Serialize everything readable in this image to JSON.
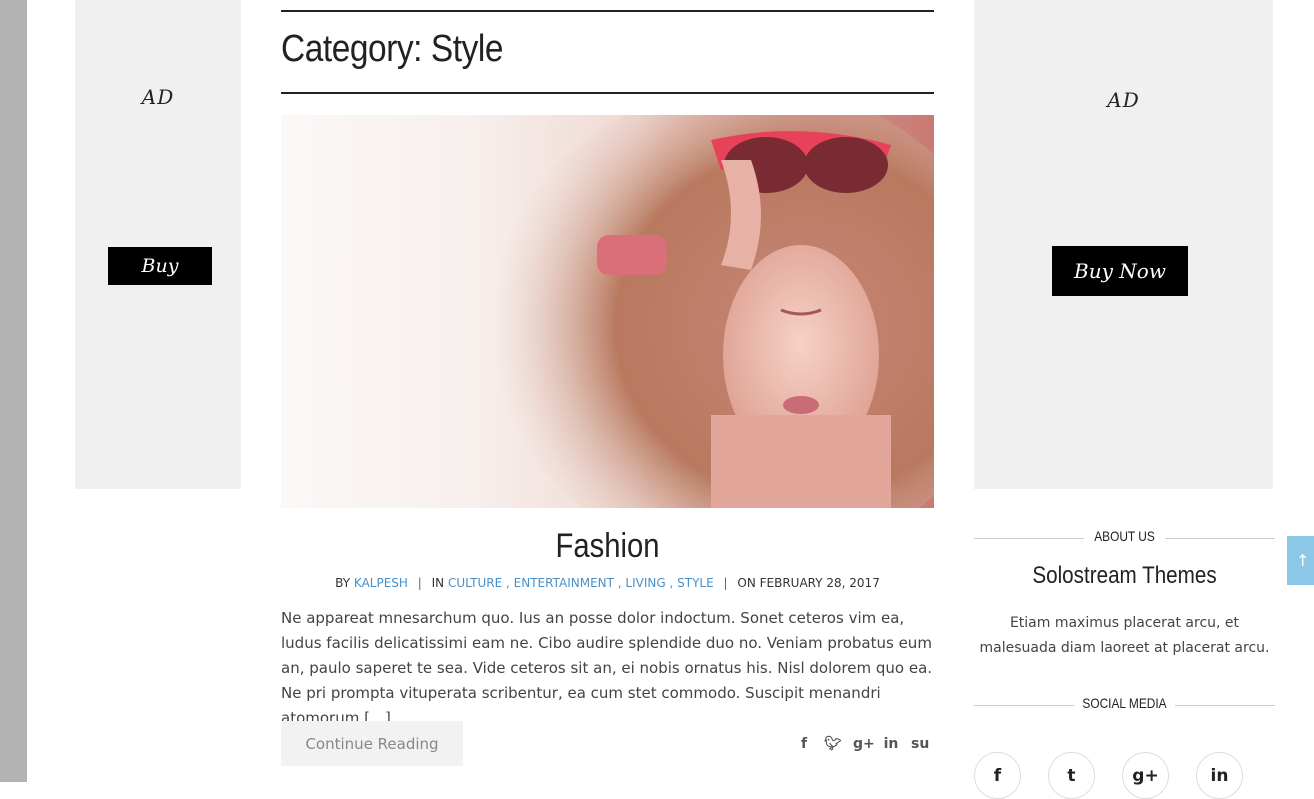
{
  "ads": {
    "left": {
      "label": "AD",
      "button": "Buy"
    },
    "right": {
      "label": "AD",
      "button": "Buy Now"
    }
  },
  "category": {
    "title": "Category: Style"
  },
  "post": {
    "image_alt": "Woman with curly hair and red sunglasses",
    "title": "Fashion",
    "meta": {
      "by_label": "BY",
      "author": "KALPESH",
      "in_label": "IN",
      "categories": [
        "CULTURE",
        "ENTERTAINMENT",
        "LIVING",
        "STYLE"
      ],
      "on_label": "ON",
      "date": "FEBRUARY 28, 2017"
    },
    "excerpt": "Ne appareat mnesarchum quo. Ius an posse dolor indoctum. Sonet ceteros vim ea, ludus facilis delicatissimi eam ne. Cibo audire splendide duo no. Veniam probatus eum an, paulo saperet te sea. Vide ceteros sit an, ei nobis ornatus his. Nisl dolorem quo ea. Ne pri prompta vituperata scribentur, ea cum stet commodo. Suscipit menandri atomorum […]",
    "continue_label": "Continue Reading",
    "share_icons": [
      "facebook-icon",
      "twitter-icon",
      "google-plus-icon",
      "linkedin-icon",
      "stumbleupon-icon"
    ]
  },
  "sidebar": {
    "about_heading": "ABOUT US",
    "about_title": "Solostream Themes",
    "about_text": "Etiam maximus placerat arcu, et malesuada diam laoreet at placerat arcu.",
    "social_heading": "SOCIAL MEDIA",
    "social_icons": [
      "facebook-icon",
      "twitter-icon",
      "google-plus-icon",
      "linkedin-icon"
    ]
  },
  "colors": {
    "link": "#4a90c8",
    "scroll_top": "#8ec8e8",
    "ad_bg": "#f0f0f0"
  }
}
